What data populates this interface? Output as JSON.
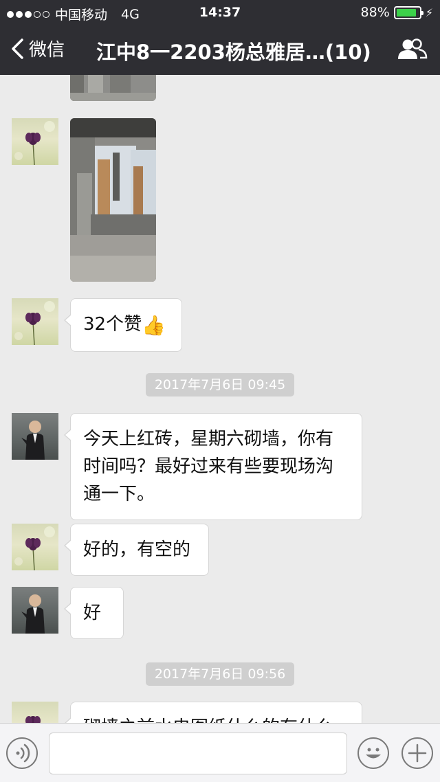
{
  "status_bar": {
    "carrier": "中国移动",
    "network": "4G",
    "time": "14:37",
    "battery": "88%",
    "battery_level": 0.88
  },
  "nav": {
    "back_label": "微信",
    "title": "江中8一2203杨总雅居…(10)"
  },
  "messages": {
    "m3": {
      "text": "32个赞"
    },
    "t1": {
      "text": "2017年7月6日 09:45"
    },
    "m4": {
      "text": "今天上红砖，星期六砌墙，你有时间吗？最好过来有些要现场沟通一下。"
    },
    "m5": {
      "text": "好的，有空的"
    },
    "m6": {
      "text": "好"
    },
    "t2": {
      "text": "2017年7月6日 09:56"
    },
    "m7": {
      "text": "砌墙之前水电图纸什么的有什么"
    }
  },
  "colors": {
    "header_bg": "#2e2e33",
    "chat_bg": "#ebebeb",
    "battery_green": "#3cd24a",
    "timestamp_bg": "#cfcfcf"
  },
  "icons": [
    "back-chevron-icon",
    "group-members-icon",
    "voice-icon",
    "emoji-icon",
    "plus-icon",
    "thumbs-up-icon"
  ]
}
